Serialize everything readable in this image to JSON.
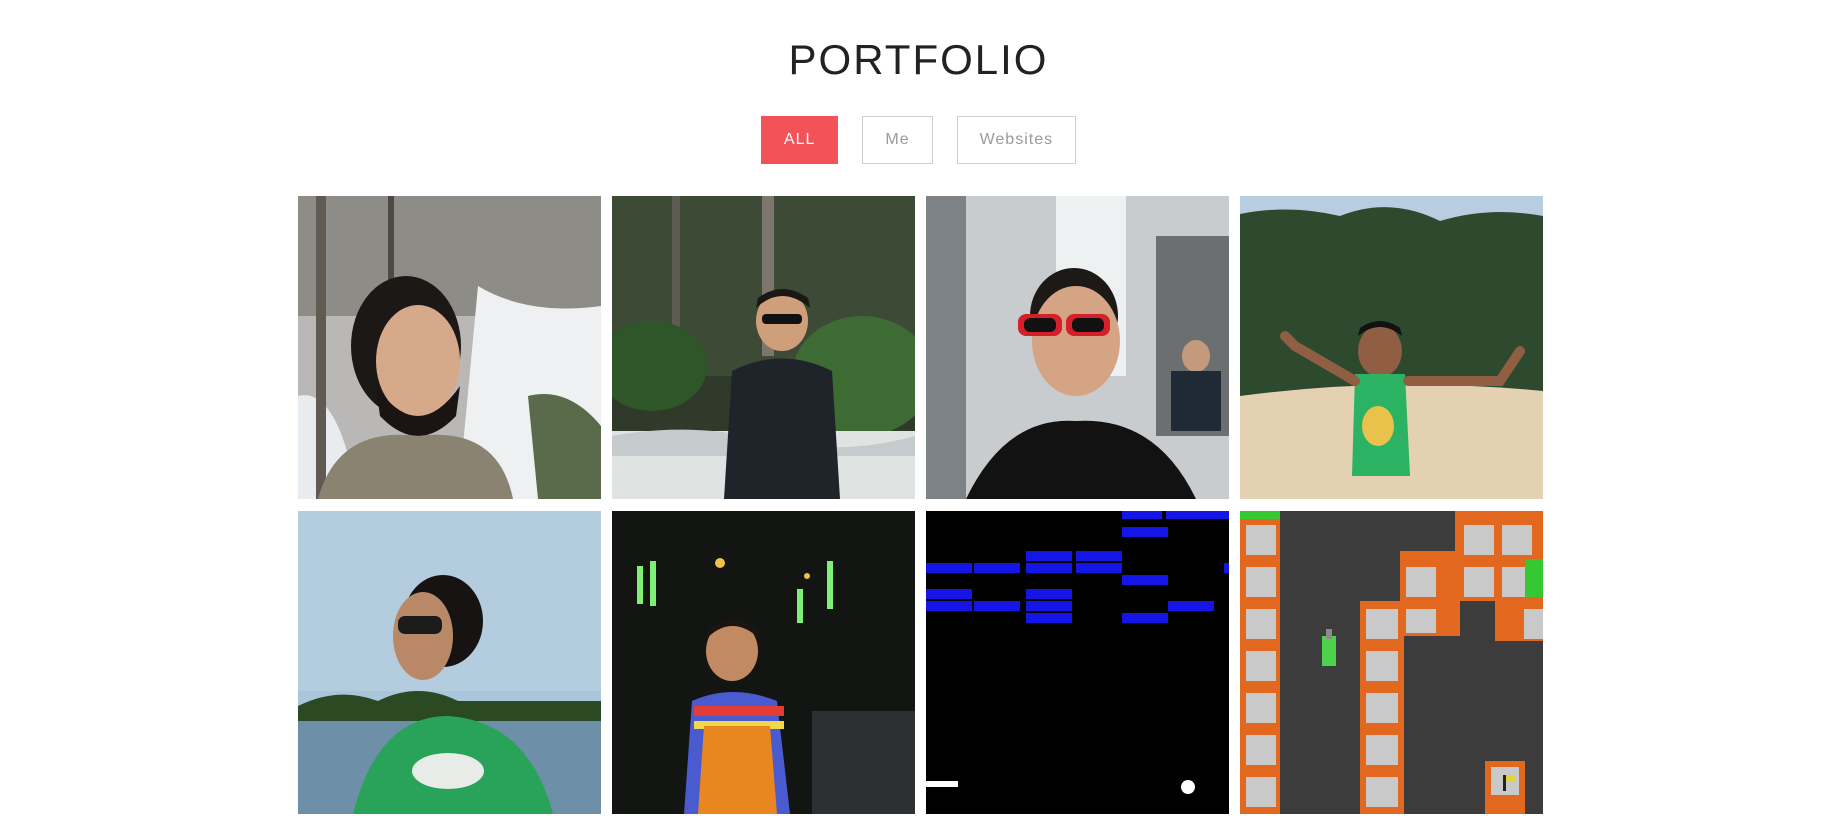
{
  "page": {
    "title": "PORTFOLIO"
  },
  "filters": [
    {
      "label": "ALL",
      "active": true
    },
    {
      "label": "Me",
      "active": false
    },
    {
      "label": "Websites",
      "active": false
    }
  ],
  "gallery": [
    {
      "category": "Me",
      "subject": "selfie by snowy stream"
    },
    {
      "category": "Me",
      "subject": "man in sunglasses by river and forest"
    },
    {
      "category": "Me",
      "subject": "man with red sunglasses at waterfall"
    },
    {
      "category": "Me",
      "subject": "man in green t-shirt dancing on sand"
    },
    {
      "category": "Me",
      "subject": "man in sunglasses by lake"
    },
    {
      "category": "Me",
      "subject": "child in orange overalls at night"
    },
    {
      "category": "Websites",
      "subject": "brick breaker game"
    },
    {
      "category": "Websites",
      "subject": "maze tank game"
    }
  ],
  "colors": {
    "accent": "#f25258"
  }
}
